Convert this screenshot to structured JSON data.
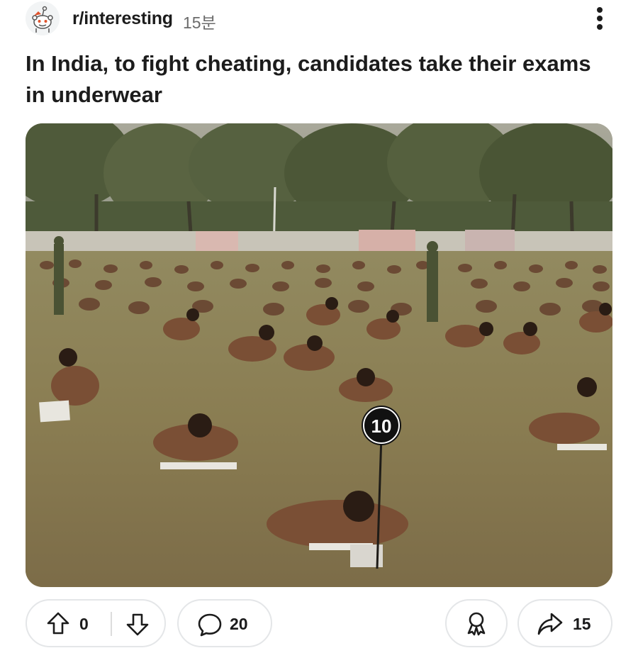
{
  "post": {
    "subreddit": "r/interesting",
    "time_ago": "15분",
    "title": "In India, to fight cheating, candidates take their exams in underwear",
    "image": {
      "sign_number": "10"
    }
  },
  "actions": {
    "score": "0",
    "comments": "20",
    "shares": "15"
  },
  "icons": {
    "avatar": "reddit-snoo-icon",
    "more": "more-vertical-icon",
    "upvote": "arrow-up-icon",
    "downvote": "arrow-down-icon",
    "comment": "speech-bubble-icon",
    "award": "award-ribbon-icon",
    "share": "share-arrow-icon"
  },
  "colors": {
    "text": "#1c1c1c",
    "muted": "#6b6b6b",
    "pill_border": "#e4e6e8",
    "grass": "#8a7d52"
  }
}
